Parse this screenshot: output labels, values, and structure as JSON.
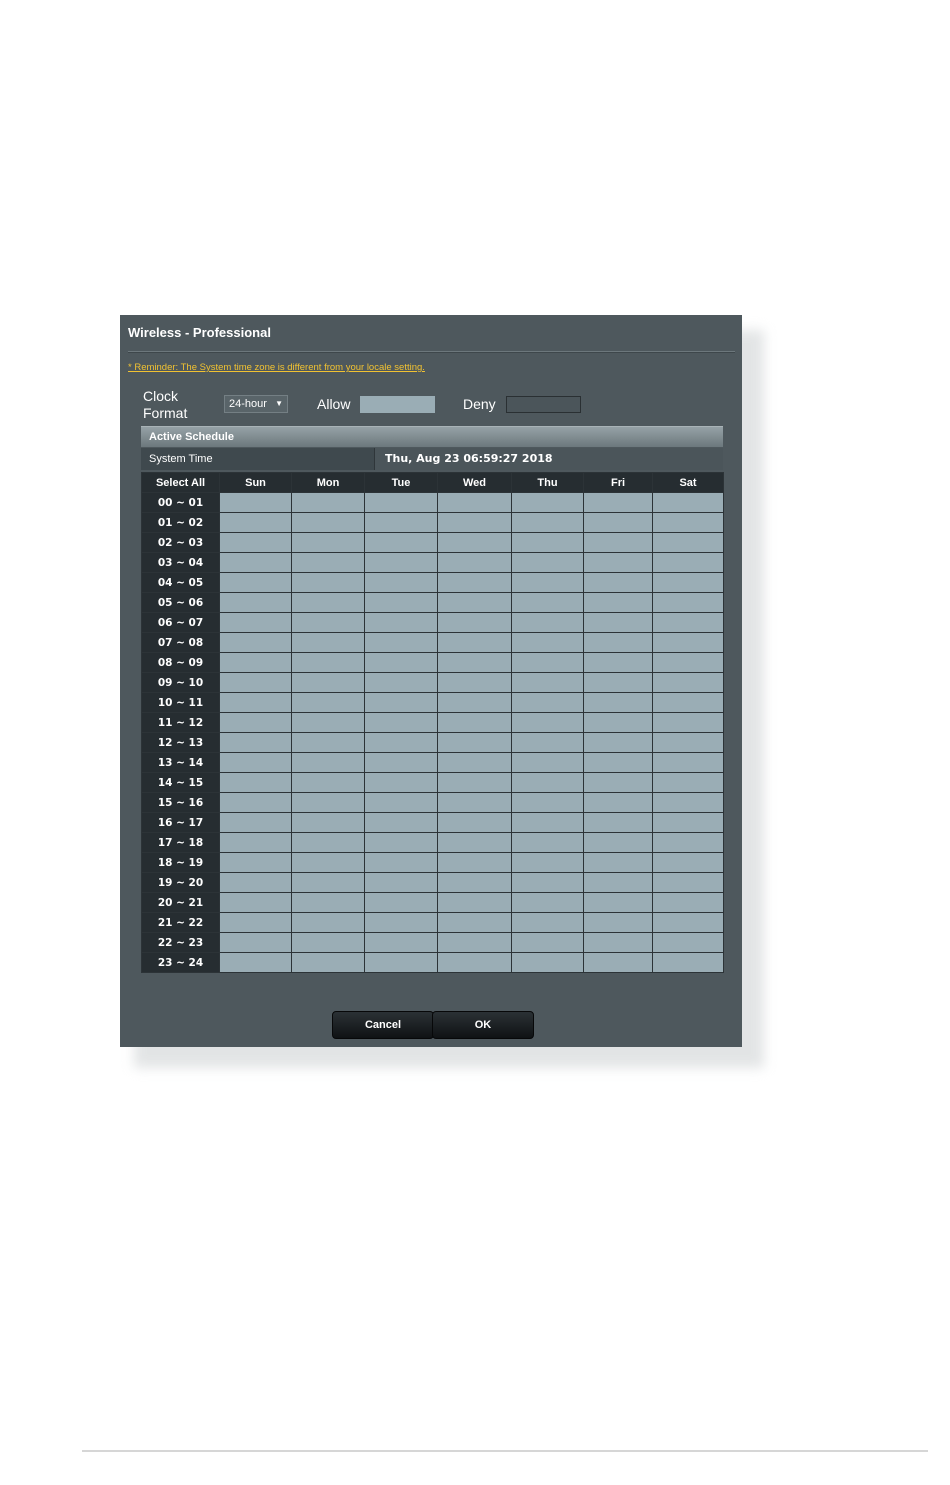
{
  "dialog": {
    "title": "Wireless - Professional",
    "reminder": "* Reminder: The System time zone is different from your locale setting."
  },
  "clock": {
    "label": "Clock Format",
    "selected": "24-hour"
  },
  "legend": {
    "allow": "Allow",
    "deny": "Deny",
    "allow_color": "#9aadb5",
    "deny_color": "#4b555a"
  },
  "schedule": {
    "header": "Active Schedule",
    "system_time_label": "System Time",
    "system_time_value": "Thu, Aug 23 06:59:27 2018",
    "select_all": "Select All",
    "days": [
      "Sun",
      "Mon",
      "Tue",
      "Wed",
      "Thu",
      "Fri",
      "Sat"
    ],
    "hours": [
      "00 ~ 01",
      "01 ~ 02",
      "02 ~ 03",
      "03 ~ 04",
      "04 ~ 05",
      "05 ~ 06",
      "06 ~ 07",
      "07 ~ 08",
      "08 ~ 09",
      "09 ~ 10",
      "10 ~ 11",
      "11 ~ 12",
      "12 ~ 13",
      "13 ~ 14",
      "14 ~ 15",
      "15 ~ 16",
      "16 ~ 17",
      "17 ~ 18",
      "18 ~ 19",
      "19 ~ 20",
      "20 ~ 21",
      "21 ~ 22",
      "22 ~ 23",
      "23 ~ 24"
    ],
    "cell_state": "allow"
  },
  "buttons": {
    "cancel": "Cancel",
    "ok": "OK"
  }
}
